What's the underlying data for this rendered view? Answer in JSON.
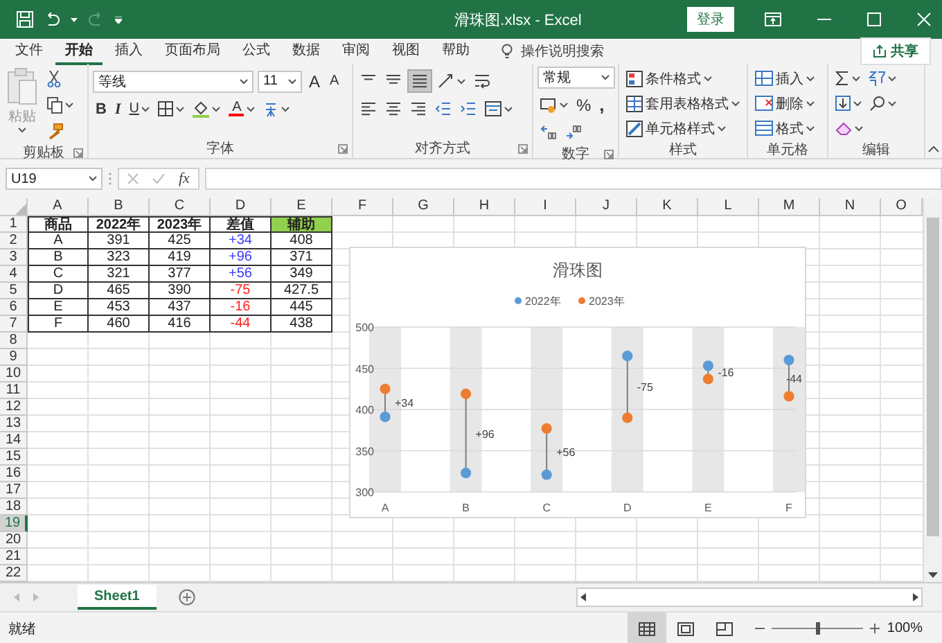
{
  "title_bar": {
    "title": "滑珠图.xlsx  -  Excel",
    "login_button": "登录"
  },
  "menu_tabs": [
    {
      "label": "文件",
      "selected": false
    },
    {
      "label": "开始",
      "selected": true
    },
    {
      "label": "插入",
      "selected": false
    },
    {
      "label": "页面布局",
      "selected": false
    },
    {
      "label": "公式",
      "selected": false
    },
    {
      "label": "数据",
      "selected": false
    },
    {
      "label": "审阅",
      "selected": false
    },
    {
      "label": "视图",
      "selected": false
    },
    {
      "label": "帮助",
      "selected": false
    }
  ],
  "tell_me": {
    "placeholder": "操作说明搜索"
  },
  "share_button": "共享",
  "ribbon": {
    "clipboard": {
      "paste": "粘贴",
      "label": "剪贴板"
    },
    "font": {
      "name": "等线",
      "size": "11",
      "grow": "A",
      "shrink": "A",
      "bold": "B",
      "italic": "I",
      "underline": "U",
      "color_letter": "A",
      "label": "字体"
    },
    "alignment": {
      "label": "对齐方式"
    },
    "number": {
      "format": "常规",
      "percent": "%",
      "comma": ",",
      "label": "数字"
    },
    "styles": {
      "items": [
        "条件格式",
        "套用表格格式",
        "单元格样式"
      ],
      "label": "样式"
    },
    "cells": {
      "items": [
        "插入",
        "删除",
        "格式"
      ],
      "label": "单元格"
    },
    "editing": {
      "label": "编辑"
    }
  },
  "formula_bar": {
    "name_box": "U19",
    "function_label": "fx"
  },
  "sheet": {
    "columns": [
      "A",
      "B",
      "C",
      "D",
      "E",
      "F",
      "G",
      "H",
      "I",
      "J",
      "K",
      "L",
      "M",
      "N",
      "O"
    ],
    "rows": [
      {
        "label": "1",
        "selected": false
      },
      {
        "label": "2",
        "selected": false
      },
      {
        "label": "3",
        "selected": false
      },
      {
        "label": "4",
        "selected": false
      },
      {
        "label": "5",
        "selected": false
      },
      {
        "label": "6",
        "selected": false
      },
      {
        "label": "7",
        "selected": false
      },
      {
        "label": "8",
        "selected": false
      },
      {
        "label": "9",
        "selected": false
      },
      {
        "label": "10",
        "selected": false
      },
      {
        "label": "11",
        "selected": false
      },
      {
        "label": "12",
        "selected": false
      },
      {
        "label": "13",
        "selected": false
      },
      {
        "label": "14",
        "selected": false
      },
      {
        "label": "15",
        "selected": false
      },
      {
        "label": "16",
        "selected": false
      },
      {
        "label": "17",
        "selected": false
      },
      {
        "label": "18",
        "selected": false
      },
      {
        "label": "19",
        "selected": true
      },
      {
        "label": "20",
        "selected": false
      },
      {
        "label": "21",
        "selected": false
      },
      {
        "label": "22",
        "selected": false
      }
    ],
    "table": {
      "header": [
        {
          "text": "商品",
          "highlighted": false
        },
        {
          "text": "2022年",
          "highlighted": false
        },
        {
          "text": "2023年",
          "highlighted": false
        },
        {
          "text": "差值",
          "highlighted": false
        },
        {
          "text": "辅助",
          "highlighted": true
        }
      ],
      "rows": [
        {
          "cells": [
            "A",
            "391",
            "425",
            "+34",
            "408"
          ],
          "kind": "increase"
        },
        {
          "cells": [
            "B",
            "323",
            "419",
            "+96",
            "371"
          ],
          "kind": "increase"
        },
        {
          "cells": [
            "C",
            "321",
            "377",
            "+56",
            "349"
          ],
          "kind": "increase"
        },
        {
          "cells": [
            "D",
            "465",
            "390",
            "-75",
            "427.5"
          ],
          "kind": "decrease"
        },
        {
          "cells": [
            "E",
            "453",
            "437",
            "-16",
            "445"
          ],
          "kind": "decrease"
        },
        {
          "cells": [
            "F",
            "460",
            "416",
            "-44",
            "438"
          ],
          "kind": "decrease"
        }
      ]
    }
  },
  "chart": {
    "chart_data": {
      "type": "scatter",
      "title": "滑珠图",
      "categories": [
        "A",
        "B",
        "C",
        "D",
        "E",
        "F"
      ],
      "series": [
        {
          "name": "2022年",
          "color": "#5b9bd5",
          "values": [
            391,
            323,
            321,
            465,
            453,
            460
          ]
        },
        {
          "name": "2023年",
          "color": "#ed7d31",
          "values": [
            425,
            419,
            377,
            390,
            437,
            416
          ]
        },
        {
          "type": "bar",
          "color": "#e7e7e7",
          "values": [
            500,
            500,
            500,
            500,
            500,
            500
          ]
        }
      ],
      "ylim": [
        300,
        500
      ],
      "yticks": [
        300,
        350,
        400,
        450,
        500
      ],
      "grid": true,
      "legend": true,
      "annotations": [
        "+34",
        "+96",
        "+56",
        "-75",
        "-16",
        "-44"
      ]
    }
  },
  "sheet_tabs": [
    {
      "label": "Sheet1",
      "selected": true
    }
  ],
  "status_bar": {
    "status": "就绪",
    "views": [
      {
        "kind": "normal",
        "selected": true
      },
      {
        "kind": "page_layout",
        "selected": false
      },
      {
        "kind": "page_break",
        "selected": false
      }
    ],
    "zoom": {
      "level": 0.5,
      "reading": "100%"
    }
  }
}
